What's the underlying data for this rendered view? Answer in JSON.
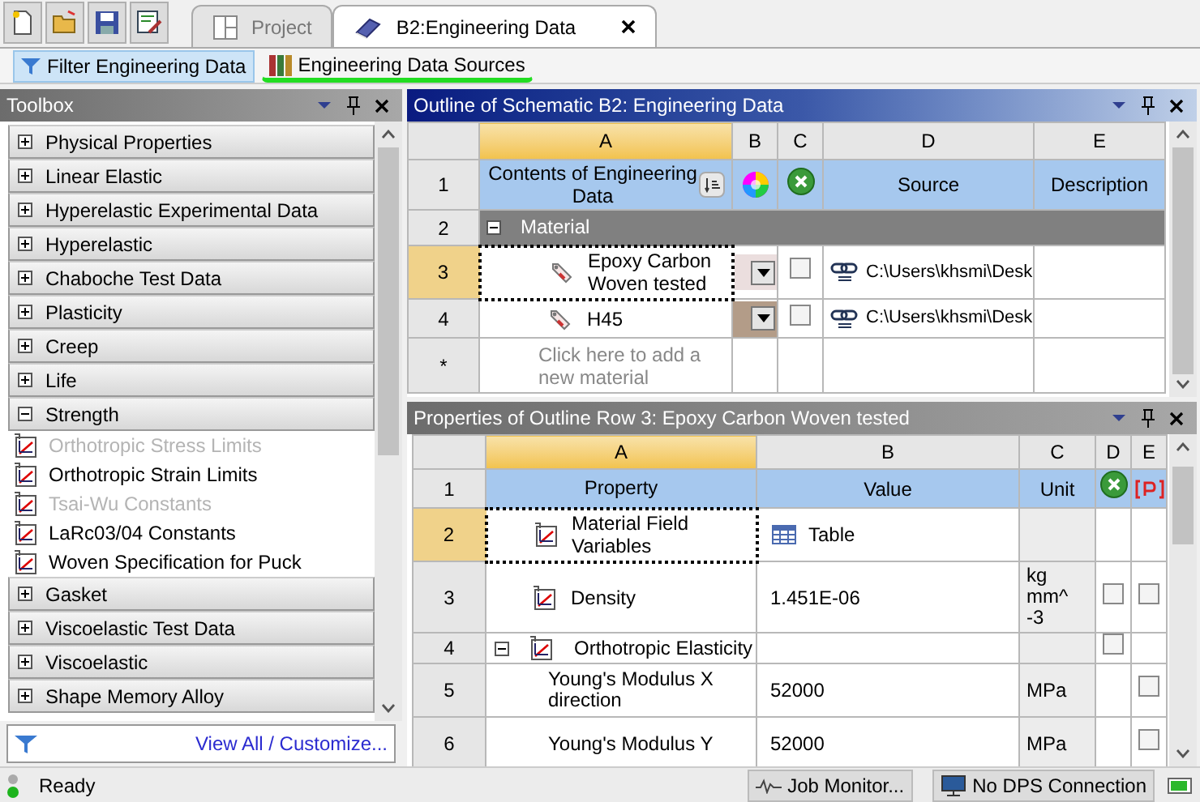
{
  "window_toolbar": {
    "tabs": [
      {
        "label": "Project",
        "selected": false
      },
      {
        "label": "B2:Engineering Data",
        "selected": true
      }
    ]
  },
  "data_toolbar": {
    "buttons": [
      {
        "label": "Filter Engineering Data",
        "selected": true,
        "underlined": false
      },
      {
        "label": "Engineering Data Sources",
        "selected": false,
        "underlined": true
      }
    ]
  },
  "toolbox": {
    "title": "Toolbox",
    "categories": [
      {
        "label": "Physical Properties",
        "expanded": false
      },
      {
        "label": "Linear Elastic",
        "expanded": false
      },
      {
        "label": "Hyperelastic Experimental Data",
        "expanded": false
      },
      {
        "label": "Hyperelastic",
        "expanded": false
      },
      {
        "label": "Chaboche Test Data",
        "expanded": false
      },
      {
        "label": "Plasticity",
        "expanded": false
      },
      {
        "label": "Creep",
        "expanded": false
      },
      {
        "label": "Life",
        "expanded": false
      },
      {
        "label": "Strength",
        "expanded": true,
        "children": [
          {
            "label": "Orthotropic Stress Limits",
            "disabled": true
          },
          {
            "label": "Orthotropic Strain Limits",
            "disabled": false
          },
          {
            "label": "Tsai-Wu Constants",
            "disabled": true
          },
          {
            "label": "LaRc03/04 Constants",
            "disabled": false
          },
          {
            "label": "Woven Specification for Puck",
            "disabled": false
          }
        ]
      },
      {
        "label": "Gasket",
        "expanded": false
      },
      {
        "label": "Viscoelastic Test Data",
        "expanded": false
      },
      {
        "label": "Viscoelastic",
        "expanded": false
      },
      {
        "label": "Shape Memory Alloy",
        "expanded": false
      }
    ],
    "footer_link": "View All / Customize..."
  },
  "outline": {
    "title": "Outline of Schematic B2: Engineering Data",
    "columns": [
      "A",
      "B",
      "C",
      "D",
      "E"
    ],
    "header_row": {
      "number": "1",
      "contents": "Contents of Engineering Data",
      "source": "Source",
      "description": "Description"
    },
    "group": {
      "number": "2",
      "label": "Material",
      "expanded": true
    },
    "materials": [
      {
        "number": "3",
        "name": "Epoxy Carbon Woven tested",
        "color": "#ebdede",
        "checked": false,
        "source": "C:\\Users\\khsmi\\Desk",
        "selected": true
      },
      {
        "number": "4",
        "name": "H45",
        "color": "#b39c88",
        "checked": false,
        "source": "C:\\Users\\khsmi\\Desk",
        "selected": false
      }
    ],
    "add_row": {
      "number": "*",
      "placeholder": "Click here to add a new material"
    }
  },
  "properties": {
    "title": "Properties of Outline Row 3: Epoxy Carbon Woven tested",
    "columns": [
      "A",
      "B",
      "C",
      "D",
      "E"
    ],
    "header_row": {
      "number": "1",
      "property": "Property",
      "value": "Value",
      "unit": "Unit"
    },
    "rows": [
      {
        "number": "2",
        "kind": "category",
        "property": "Material Field Variables",
        "value": "Table",
        "selected": true
      },
      {
        "number": "3",
        "kind": "category",
        "property": "Density",
        "value": "1.451E-06",
        "unit": "kg mm^-3",
        "d_checked": false,
        "e_checked": false,
        "selected": false
      },
      {
        "number": "4",
        "kind": "group",
        "property": "Orthotropic Elasticity",
        "expanded": true,
        "d_checked": false,
        "selected": false
      },
      {
        "number": "5",
        "kind": "child",
        "property": "Young's Modulus X direction",
        "value": "52000",
        "unit": "MPa",
        "e_checked": false,
        "selected": false
      },
      {
        "number": "6",
        "kind": "child",
        "property": "Young's Modulus Y",
        "value": "52000",
        "unit": "MPa",
        "e_checked": false,
        "selected": false
      }
    ]
  },
  "status_bar": {
    "status": "Ready",
    "job_monitor": "Job Monitor...",
    "dps": "No DPS Connection"
  }
}
